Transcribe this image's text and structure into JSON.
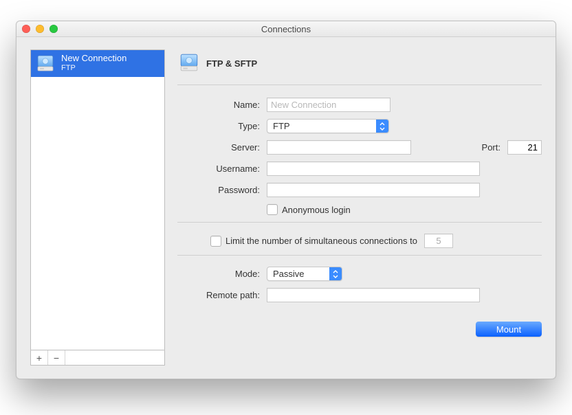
{
  "window": {
    "title": "Connections"
  },
  "sidebar": {
    "items": [
      {
        "name": "New Connection",
        "subtitle": "FTP"
      }
    ],
    "add_label": "+",
    "remove_label": "−"
  },
  "panel": {
    "title": "FTP & SFTP"
  },
  "form": {
    "name_label": "Name:",
    "name_placeholder": "New Connection",
    "name_value": "",
    "type_label": "Type:",
    "type_value": "FTP",
    "server_label": "Server:",
    "server_value": "",
    "port_label": "Port:",
    "port_value": "21",
    "username_label": "Username:",
    "username_value": "",
    "password_label": "Password:",
    "password_value": "",
    "anonymous_label": "Anonymous login",
    "limit_label": "Limit the number of simultaneous connections to",
    "limit_value": "5",
    "mode_label": "Mode:",
    "mode_value": "Passive",
    "remote_label": "Remote path:",
    "remote_value": "",
    "mount_label": "Mount"
  }
}
